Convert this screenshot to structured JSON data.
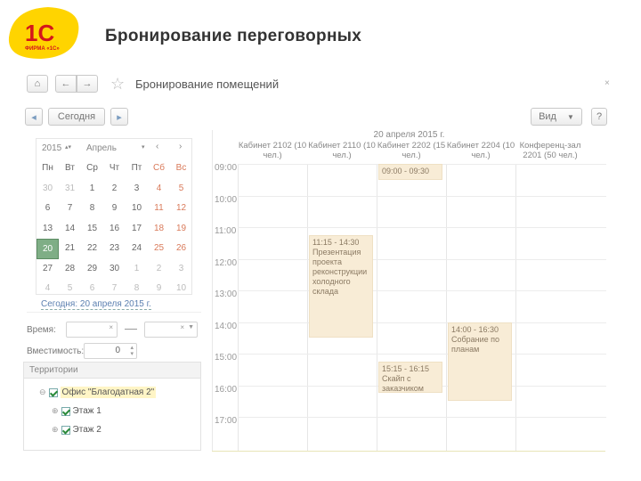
{
  "slide_title": "Бронирование переговорных",
  "logo": {
    "text": "1С",
    "sub": "ФИРМА «1С»"
  },
  "window": {
    "title": "Бронирование помещений",
    "close": "×"
  },
  "toolbar": {
    "today_label": "Сегодня",
    "view_label": "Вид",
    "help_label": "?"
  },
  "calendar": {
    "year": "2015",
    "month": "Апрель",
    "weekdays": [
      "Пн",
      "Вт",
      "Ср",
      "Чт",
      "Пт",
      "Сб",
      "Вс"
    ],
    "weeks": [
      [
        "30",
        "31",
        "1",
        "2",
        "3",
        "4",
        "5"
      ],
      [
        "6",
        "7",
        "8",
        "9",
        "10",
        "11",
        "12"
      ],
      [
        "13",
        "14",
        "15",
        "16",
        "17",
        "18",
        "19"
      ],
      [
        "20",
        "21",
        "22",
        "23",
        "24",
        "25",
        "26"
      ],
      [
        "27",
        "28",
        "29",
        "30",
        "1",
        "2",
        "3"
      ],
      [
        "4",
        "5",
        "6",
        "7",
        "8",
        "9",
        "10"
      ]
    ],
    "selected": "20",
    "today_link": "Сегодня: 20 апреля 2015 г."
  },
  "filters": {
    "time_label": "Время:",
    "capacity_label": "Вместимость:",
    "capacity_value": "0"
  },
  "territory": {
    "header": "Территории",
    "items": [
      {
        "label": "Офис \"Благодатная 2\""
      },
      {
        "label": "Этаж 1"
      },
      {
        "label": "Этаж 2"
      }
    ]
  },
  "schedule": {
    "date": "20 апреля 2015 г.",
    "rooms": [
      "Кабинет 2102 (10 чел.)",
      "Кабинет 2110 (10 чел.)",
      "Кабинет 2202 (15 чел.)",
      "Кабинет 2204 (10 чел.)",
      "Конференц-зал 2201 (50 чел.)"
    ],
    "times": [
      "09:00",
      "10:00",
      "11:00",
      "12:00",
      "13:00",
      "14:00",
      "15:00",
      "16:00",
      "17:00"
    ],
    "events": [
      {
        "room": 2,
        "start": 9.0,
        "end": 9.5,
        "text": "09:00 - 09:30"
      },
      {
        "room": 1,
        "start": 11.25,
        "end": 14.5,
        "text": "11:15 - 14:30 Презентация проекта реконструкции холодного склада"
      },
      {
        "room": 3,
        "start": 14.0,
        "end": 16.5,
        "text": "14:00 - 16:30 Собрание по планам"
      },
      {
        "room": 2,
        "start": 15.25,
        "end": 16.25,
        "text": "15:15 - 16:15 Скайп с заказчиком"
      }
    ]
  }
}
